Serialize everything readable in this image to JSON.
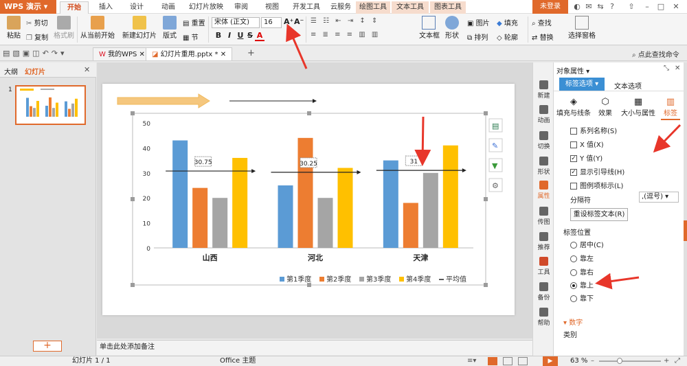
{
  "titlebar": {
    "app_menu": "WPS 演示",
    "tabs": [
      "开始",
      "插入",
      "设计",
      "动画",
      "幻灯片放映",
      "审阅",
      "视图",
      "开发工具",
      "云服务",
      "绘图工具",
      "文本工具",
      "图表工具"
    ],
    "login": "未登录"
  },
  "ribbon": {
    "paste": "粘贴",
    "cut": "剪切",
    "copy": "复制",
    "format_painter": "格式刷",
    "from_current": "从当前开始",
    "new_slide": "新建幻灯片",
    "layout": "版式",
    "reset": "重置",
    "section": "节",
    "font_name": "宋体 (正文)",
    "font_size": "16",
    "bold": "B",
    "italic": "I",
    "underline": "U",
    "strike": "S",
    "font_color": "A",
    "textbox": "文本框",
    "shape": "形状",
    "picture": "图片",
    "fill": "填充",
    "arrange": "排列",
    "outline": "轮廓",
    "find": "查找",
    "replace": "替换",
    "select_pane": "选择窗格"
  },
  "quickbar": {
    "doc_tabs": [
      "我的WPS",
      "幻灯片重用.pptx *"
    ],
    "search": "点此查找命令"
  },
  "leftpanel": {
    "tab_outline": "大纲",
    "tab_slides": "幻灯片",
    "slide_number": "1",
    "add": "+"
  },
  "notes": "单击此处添加备注",
  "chart_data": {
    "type": "bar",
    "categories": [
      "山西",
      "河北",
      "天津"
    ],
    "series": [
      {
        "name": "第1季度",
        "values": [
          43,
          25,
          35
        ],
        "color": "#5b9bd5"
      },
      {
        "name": "第2季度",
        "values": [
          24,
          44,
          18
        ],
        "color": "#ed7d31"
      },
      {
        "name": "第3季度",
        "values": [
          20,
          20,
          30
        ],
        "color": "#a5a5a5"
      },
      {
        "name": "第4季度",
        "values": [
          36,
          32,
          41
        ],
        "color": "#ffc000"
      }
    ],
    "average": {
      "name": "平均值",
      "values": [
        30.75,
        30.25,
        31
      ]
    },
    "ylim": [
      0,
      50
    ],
    "yticks": [
      0,
      10,
      20,
      30,
      40,
      50
    ],
    "legend_position": "bottom",
    "grid": false
  },
  "propanel": {
    "title": "对象属性",
    "tab_label_options": "标签选项",
    "tab_text_options": "文本选项",
    "subtabs": [
      "填充与线条",
      "效果",
      "大小与属性",
      "标签"
    ],
    "checks": [
      {
        "label": "系列名称(S)",
        "checked": false
      },
      {
        "label": "X 值(X)",
        "checked": false
      },
      {
        "label": "Y 值(Y)",
        "checked": true
      },
      {
        "label": "显示引导线(H)",
        "checked": true
      },
      {
        "label": "图例项标示(L)",
        "checked": false
      }
    ],
    "separator_label": "分隔符",
    "separator_value": ",(逗号)",
    "reset_button": "重设标签文本(R)",
    "position_label": "标签位置",
    "positions": [
      {
        "label": "居中(C)",
        "checked": false
      },
      {
        "label": "靠左",
        "checked": false
      },
      {
        "label": "靠右",
        "checked": false
      },
      {
        "label": "靠上",
        "checked": true
      },
      {
        "label": "靠下",
        "checked": false
      }
    ],
    "number_label": "数字",
    "category_label": "类别"
  },
  "rsidebar": [
    "新建",
    "动画",
    "切换",
    "形状",
    "属性",
    "传图",
    "推荐",
    "工具",
    "备份",
    "帮助"
  ],
  "statusbar": {
    "slide_info": "幻灯片 1 / 1",
    "theme": "Office 主题",
    "zoom": "63 %"
  },
  "colors": {
    "accent": "#e0692b",
    "arrow": "#e8362a"
  }
}
